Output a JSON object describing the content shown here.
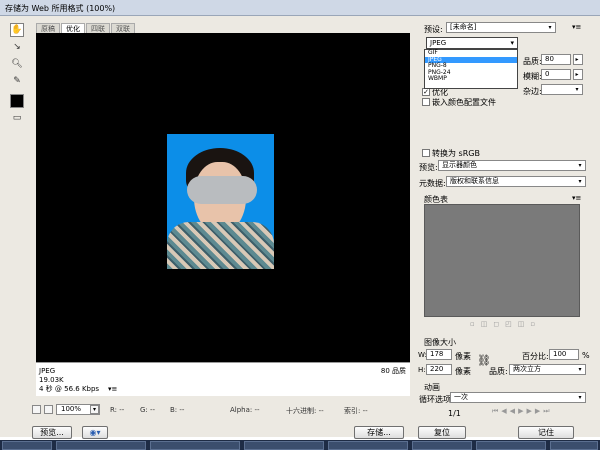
{
  "window": {
    "title": "存储为 Web 所用格式 (100%)"
  },
  "view_tabs": [
    "原稿",
    "优化",
    "四联",
    "双联"
  ],
  "info_panel": {
    "format": "JPEG",
    "size": "19.03K",
    "time": "4 秒 @ 56.6 Kbps",
    "menu_glyph": "▾≡",
    "quality": "80 品质"
  },
  "status_bar": {
    "zoom": "100%",
    "r": "R: --",
    "g": "G: --",
    "b": "B: --",
    "alpha": "Alpha: --",
    "hex": "十六进制: --",
    "index": "索引: --"
  },
  "settings": {
    "preset_label": "预设:",
    "preset_value": "[未命名]",
    "format_value": "JPEG",
    "format_options": [
      "GIF",
      "JPEG",
      "PNG-8",
      "PNG-24",
      "WBMP"
    ],
    "format_selected_index": 1,
    "quality_label": "品质:",
    "quality_value": "80",
    "blur_label": "模糊:",
    "blur_value": "0",
    "matte_label": "杂边:",
    "optimized_label": "优化",
    "optimized_checked": true,
    "embed_profile_label": "嵌入颜色配置文件",
    "convert_srgb_label": "转换为 sRGB",
    "preview_label": "预览:",
    "preview_value": "显示器颜色",
    "metadata_label": "元数据:",
    "metadata_value": "版权和联系信息",
    "color_table_label": "颜色表"
  },
  "image_size": {
    "section_label": "图像大小",
    "w_label": "W:",
    "w_value": "178",
    "w_unit": "像素",
    "h_label": "H:",
    "h_value": "220",
    "h_unit": "像素",
    "percent_label": "百分比:",
    "percent_value": "100",
    "percent_unit": "%",
    "quality_label": "品质:",
    "quality_value": "两次立方"
  },
  "animation": {
    "section_label": "动画",
    "loop_label": "循环选项:",
    "loop_value": "一次",
    "frame_counter": "1/1"
  },
  "buttons": {
    "preview": "预览...",
    "save": "存储...",
    "reset": "复位",
    "remember": "记住"
  },
  "colors": {
    "canvas": "#000000",
    "photo_bg": "#0c8ee8",
    "panel": "#ece9e2",
    "color_table": "#7a7a7a",
    "highlight": "#3399ff"
  }
}
